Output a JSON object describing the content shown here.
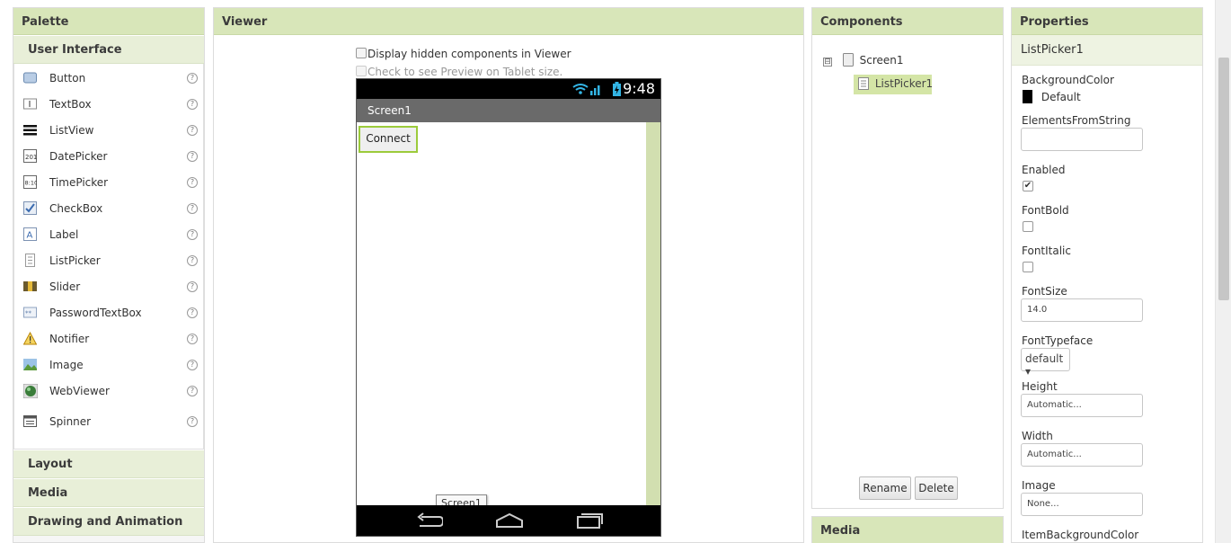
{
  "palette": {
    "header": "Palette",
    "categories": {
      "user_interface": "User Interface",
      "layout": "Layout",
      "media": "Media",
      "drawing": "Drawing and Animation"
    },
    "items": [
      {
        "label": "Button",
        "icon": "button-icon"
      },
      {
        "label": "TextBox",
        "icon": "textbox-icon"
      },
      {
        "label": "ListView",
        "icon": "listview-icon"
      },
      {
        "label": "DatePicker",
        "icon": "datepicker-icon"
      },
      {
        "label": "TimePicker",
        "icon": "timepicker-icon"
      },
      {
        "label": "CheckBox",
        "icon": "checkbox-icon"
      },
      {
        "label": "Label",
        "icon": "label-icon"
      },
      {
        "label": "ListPicker",
        "icon": "listpicker-icon"
      },
      {
        "label": "Slider",
        "icon": "slider-icon"
      },
      {
        "label": "PasswordTextBox",
        "icon": "passwordtextbox-icon"
      },
      {
        "label": "Notifier",
        "icon": "notifier-icon"
      },
      {
        "label": "Image",
        "icon": "image-icon"
      },
      {
        "label": "WebViewer",
        "icon": "webviewer-icon"
      },
      {
        "label": "Spinner",
        "icon": "spinner-icon"
      }
    ],
    "help_glyph": "?"
  },
  "viewer": {
    "header": "Viewer",
    "display_hidden_label": "Display hidden components in Viewer",
    "tablet_preview_label": "Check to see Preview on Tablet size.",
    "phone": {
      "time": "9:48",
      "screen_title": "Screen1",
      "connect_label": "Connect",
      "tooltip": "Screen1"
    }
  },
  "components": {
    "header": "Components",
    "tree": {
      "root": "Screen1",
      "child": "ListPicker1",
      "toggle": "⊟"
    },
    "rename_label": "Rename",
    "delete_label": "Delete",
    "media_header": "Media"
  },
  "properties": {
    "header": "Properties",
    "component": "ListPicker1",
    "background_color_label": "BackgroundColor",
    "background_color_value": "Default",
    "elements_from_string_label": "ElementsFromString",
    "elements_from_string_value": "",
    "enabled_label": "Enabled",
    "enabled_checked": "✔",
    "font_bold_label": "FontBold",
    "font_italic_label": "FontItalic",
    "font_size_label": "FontSize",
    "font_size_value": "14.0",
    "font_typeface_label": "FontTypeface",
    "font_typeface_value": "default ▾",
    "height_label": "Height",
    "height_value": "Automatic...",
    "width_label": "Width",
    "width_value": "Automatic...",
    "image_label": "Image",
    "image_value": "None...",
    "item_bg_color_label": "ItemBackgroundColor"
  },
  "colors": {
    "header_green": "#d8e6b9",
    "selection_green": "#d4e5a6",
    "accent_green": "#9ccb3b",
    "phone_status": "#000000",
    "phone_titlebar": "#6a6a6a"
  }
}
